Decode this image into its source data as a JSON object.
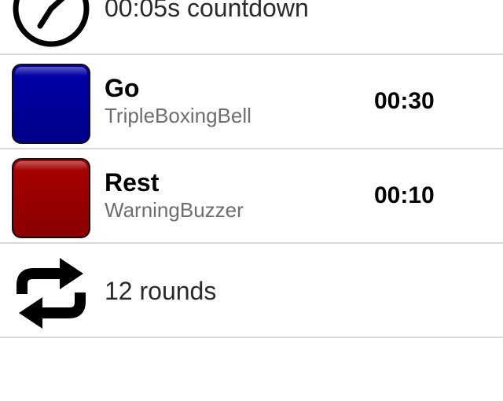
{
  "countdown": {
    "label": "00:05s countdown",
    "icon": "stopwatch-icon"
  },
  "intervals": [
    {
      "name": "Go",
      "sound": "TripleBoxingBell",
      "duration": "00:30",
      "color": "#000099"
    },
    {
      "name": "Rest",
      "sound": "WarningBuzzer",
      "duration": "00:10",
      "color": "#990000"
    }
  ],
  "rounds": {
    "label": "12 rounds",
    "icon": "repeat-icon"
  }
}
